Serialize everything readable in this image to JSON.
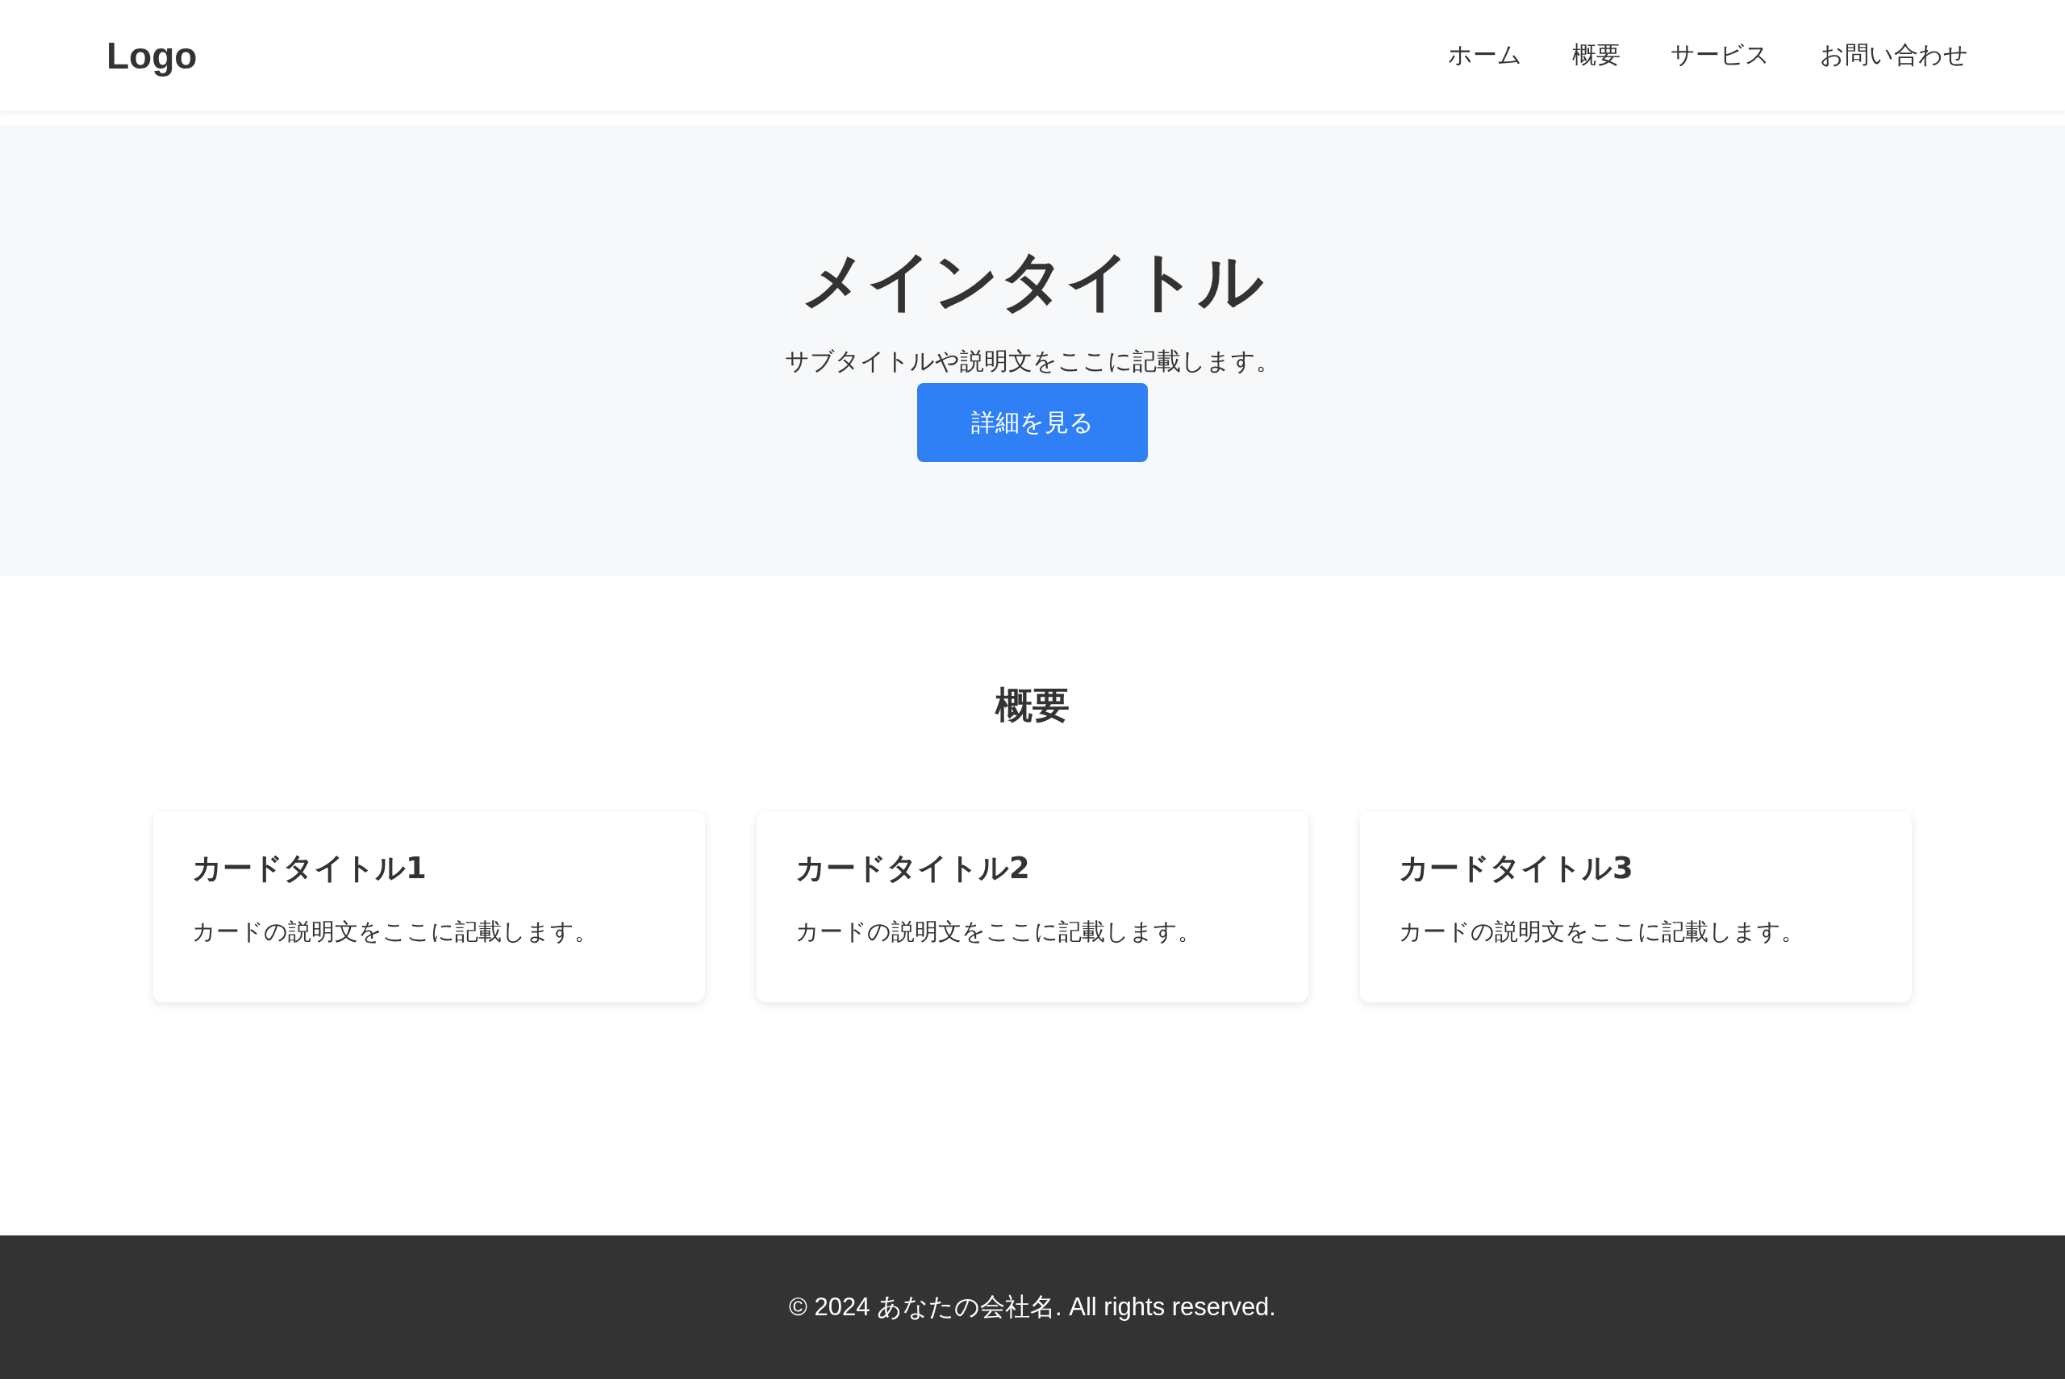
{
  "header": {
    "logo": "Logo",
    "nav": [
      {
        "label": "ホーム"
      },
      {
        "label": "概要"
      },
      {
        "label": "サービス"
      },
      {
        "label": "お問い合わせ"
      }
    ]
  },
  "hero": {
    "title": "メインタイトル",
    "subtitle": "サブタイトルや説明文をここに記載します。",
    "button": "詳細を見る"
  },
  "section": {
    "heading": "概要",
    "cards": [
      {
        "title": "カードタイトル1",
        "description": "カードの説明文をここに記載します。"
      },
      {
        "title": "カードタイトル2",
        "description": "カードの説明文をここに記載します。"
      },
      {
        "title": "カードタイトル3",
        "description": "カードの説明文をここに記載します。"
      }
    ]
  },
  "footer": {
    "text": "© 2024 あなたの会社名. All rights reserved."
  }
}
